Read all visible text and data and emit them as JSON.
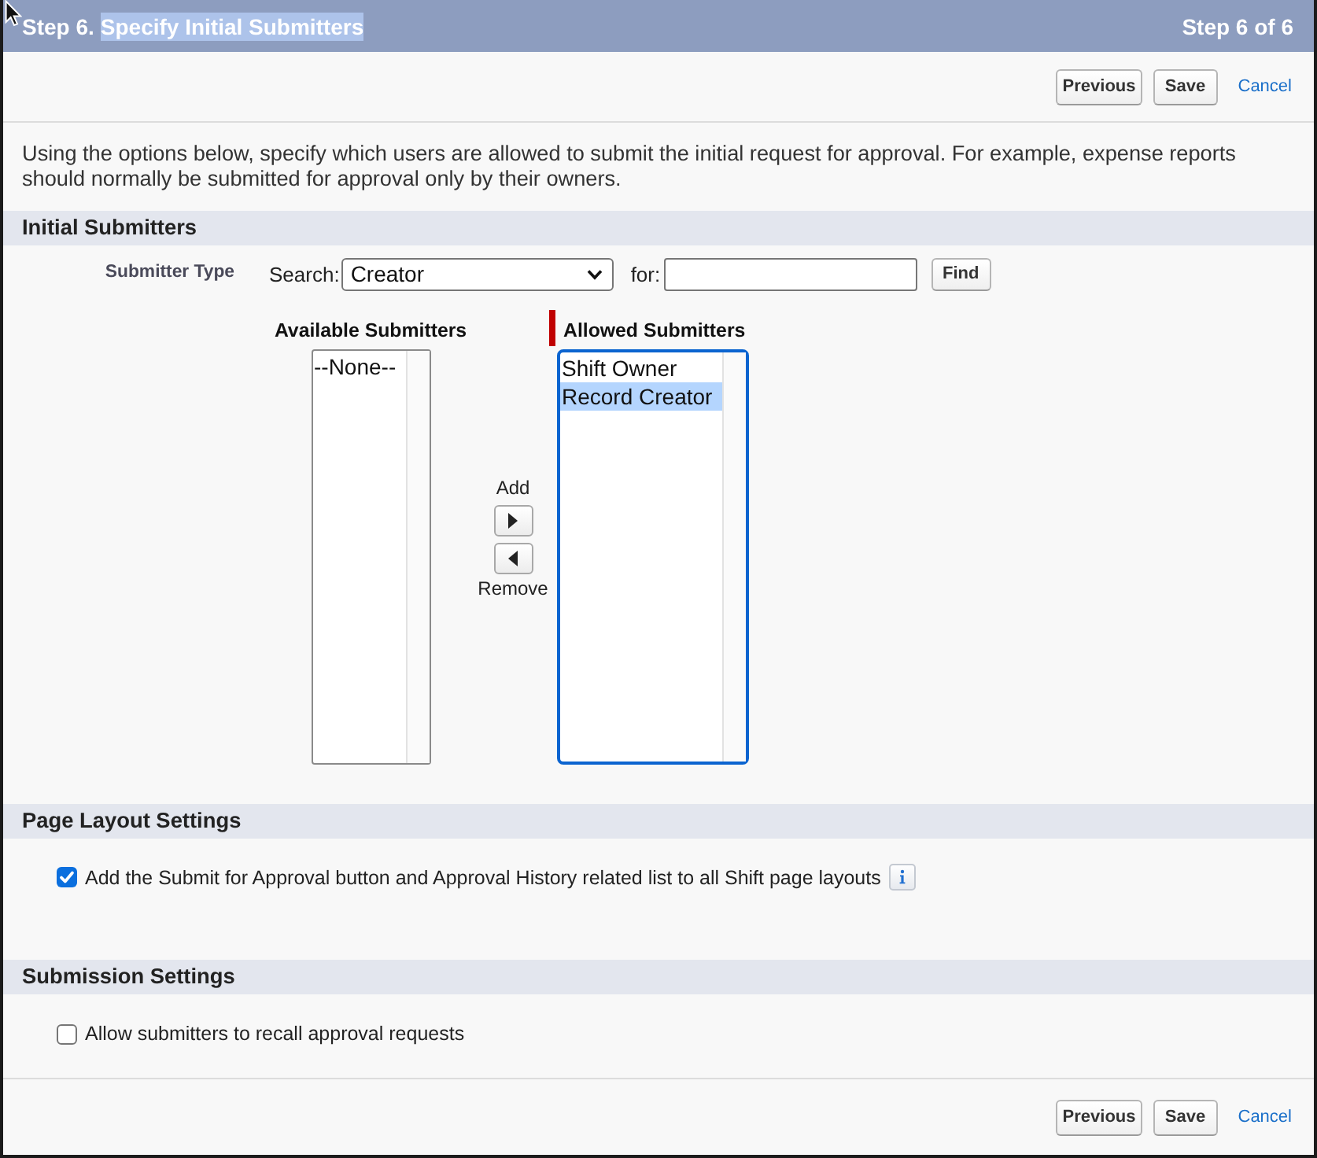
{
  "header": {
    "title": [
      {
        "text": "Step 6.",
        "highlighted": false
      },
      {
        "text": "Specify Initial Submitters",
        "highlighted": true
      }
    ],
    "step": "Step 6 of 6"
  },
  "top_actions": [
    {
      "kind": "button",
      "label": "Previous"
    },
    {
      "kind": "button",
      "label": "Save"
    },
    {
      "kind": "link",
      "label": "Cancel"
    }
  ],
  "description": "Using the options below, specify which users are allowed to submit the initial request for approval. For example, expense reports should normally be submitted for approval only by their owners.",
  "initial_submitters": {
    "title": "Initial Submitters",
    "field_label": "Submitter Type",
    "search_label": "Search:",
    "search_value": "Creator",
    "for_label": "for:",
    "find_button": "Find",
    "available": {
      "label": "Available Submitters",
      "required": false,
      "focused": false,
      "options": [
        {
          "text": "--None--",
          "selected": false
        }
      ]
    },
    "add_label": "Add",
    "remove_label": "Remove",
    "allowed": {
      "label": "Allowed Submitters",
      "required": true,
      "focused": true,
      "options": [
        {
          "text": "Shift Owner",
          "selected": false
        },
        {
          "text": "Record Creator",
          "selected": true
        }
      ]
    }
  },
  "settings": [
    {
      "title": "Page Layout Settings",
      "options": [
        {
          "label": "Add the Submit for Approval button and Approval History related list to all Shift page layouts",
          "checked": true,
          "info": true
        }
      ]
    },
    {
      "title": "Submission Settings",
      "options": [
        {
          "label": "Allow submitters to recall approval requests",
          "checked": false,
          "info": false
        }
      ]
    }
  ],
  "bottom_actions": [
    {
      "kind": "button",
      "label": "Previous"
    },
    {
      "kind": "button",
      "label": "Save"
    },
    {
      "kind": "link",
      "label": "Cancel"
    }
  ]
}
